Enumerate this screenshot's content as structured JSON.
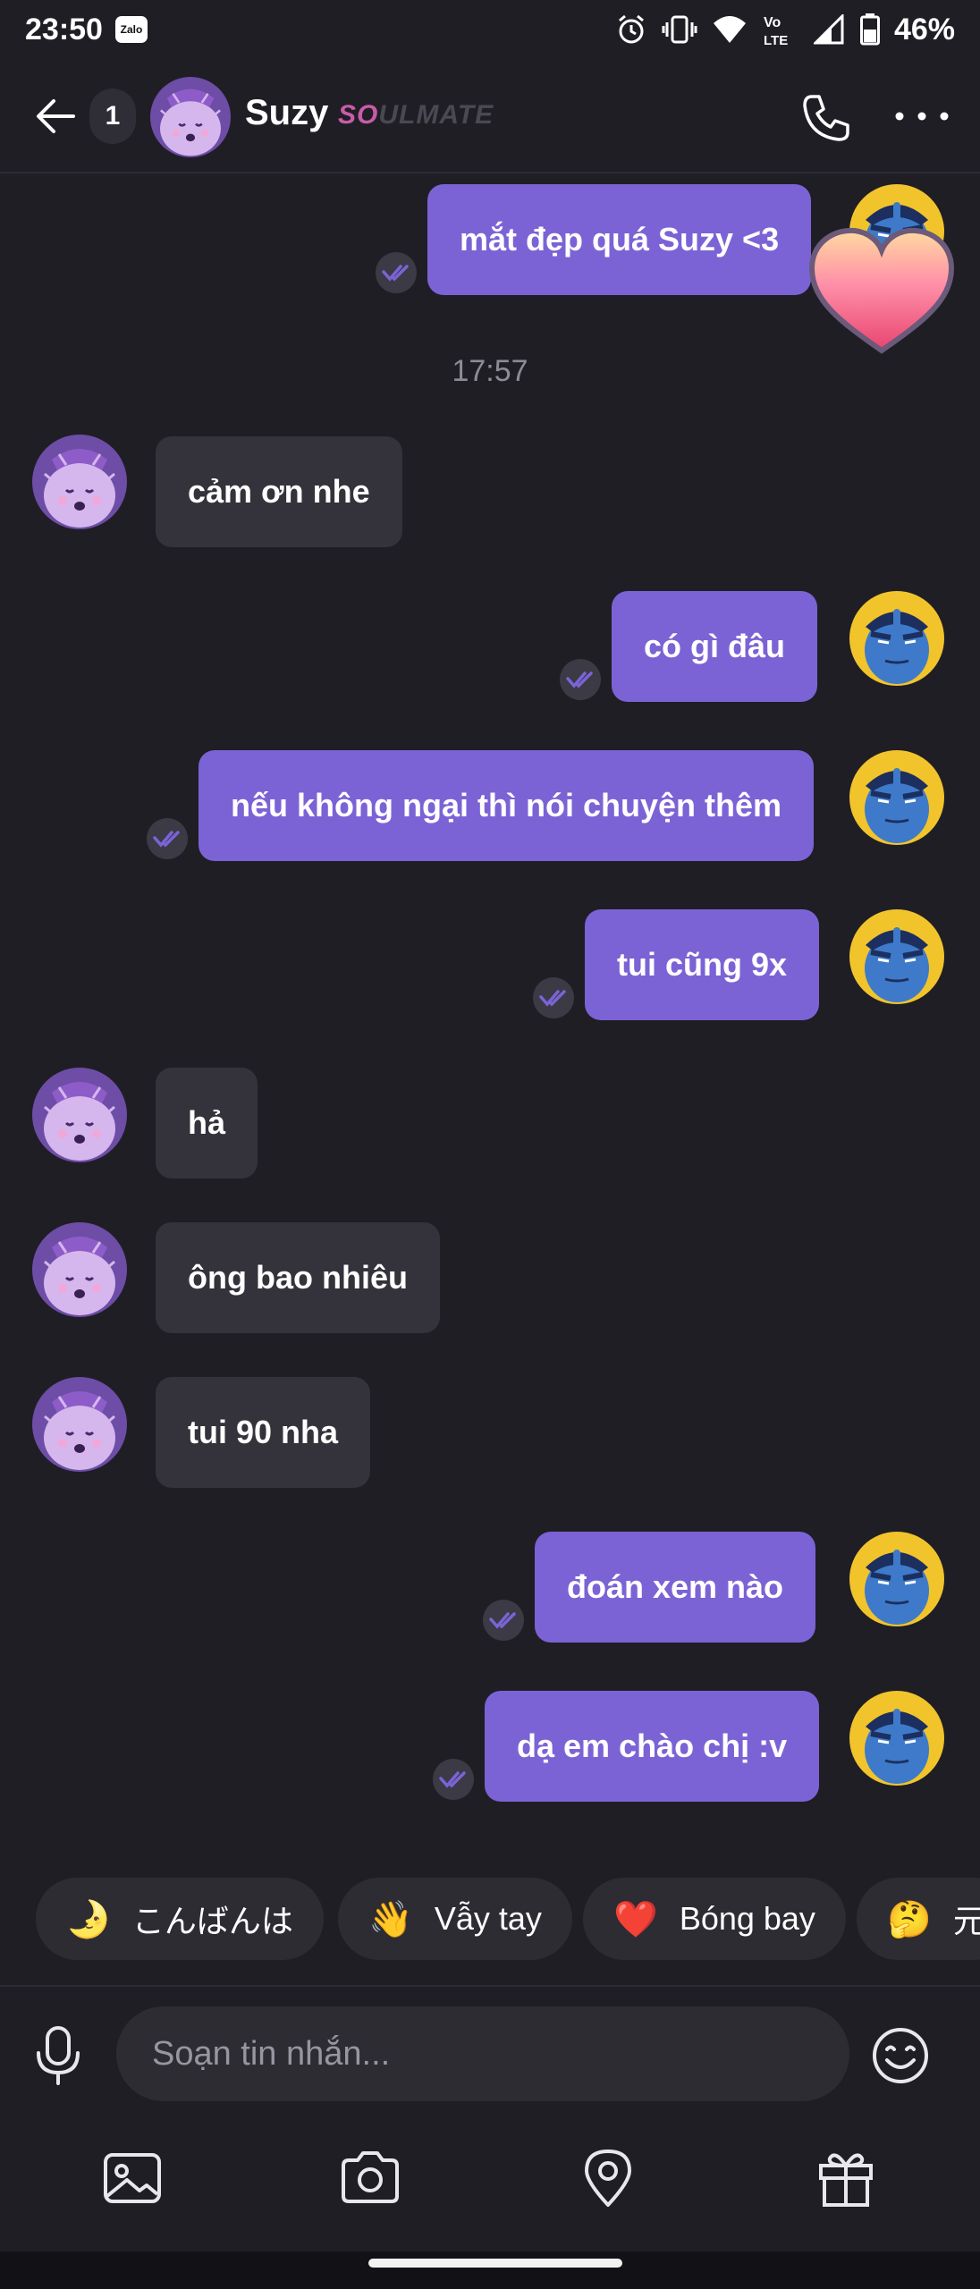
{
  "status_bar": {
    "time": "23:50",
    "notification_app": "Zalo",
    "battery": "46%",
    "network": "VoLTE"
  },
  "header": {
    "unread_count": "1",
    "contact_name": "Suzy",
    "badge_so": "SO",
    "badge_rest": "ULMATE"
  },
  "messages": [
    {
      "direction": "out",
      "text": "mắt đẹp quá Suzy <3",
      "reaction": "heart"
    },
    {
      "direction": "in",
      "text": "cảm ơn nhe"
    },
    {
      "direction": "out",
      "text": "có gì đâu"
    },
    {
      "direction": "out",
      "text": "nếu không ngại thì nói chuyện thêm"
    },
    {
      "direction": "out",
      "text": "tui cũng 9x"
    },
    {
      "direction": "in",
      "text": "hả"
    },
    {
      "direction": "in",
      "text": "ông bao nhiêu"
    },
    {
      "direction": "in",
      "text": "tui 90 nha"
    },
    {
      "direction": "out",
      "text": "đoán xem nào"
    },
    {
      "direction": "out",
      "text": "dạ em chào chị :v"
    }
  ],
  "time_separator": "17:57",
  "quick_replies": [
    {
      "emoji": "🌛",
      "label": "こんばんは"
    },
    {
      "emoji": "👋",
      "label": "Vẫy tay"
    },
    {
      "emoji": "❤️",
      "label": "Bóng bay"
    },
    {
      "emoji": "🤔",
      "label": "元"
    }
  ],
  "composer": {
    "placeholder": "Soạn tin nhắn..."
  },
  "toolbar": {
    "icons": [
      "image-icon",
      "camera-icon",
      "location-pin-icon",
      "gift-icon"
    ]
  },
  "colors": {
    "background": "#1f1e25",
    "outgoing_bubble": "#7b63d6",
    "incoming_bubble": "#34333b",
    "accent": "#7b63d6"
  }
}
